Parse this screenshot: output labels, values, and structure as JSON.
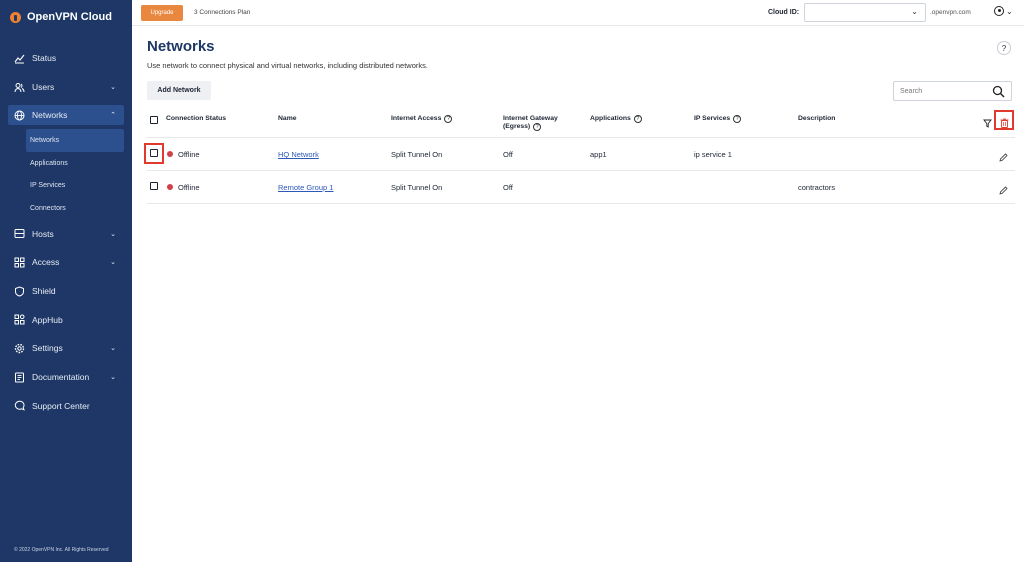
{
  "brand": {
    "name": "OpenVPN Cloud"
  },
  "colors": {
    "sidebar": "#1e3766",
    "accent": "#e9873f",
    "status_offline": "#d2404a",
    "highlight": "#e03a2f",
    "link": "#2c58b8"
  },
  "sidebar": {
    "items": [
      {
        "label": "Status",
        "icon": "chart-line-icon",
        "chevron": false
      },
      {
        "label": "Users",
        "icon": "users-icon",
        "chevron": true
      },
      {
        "label": "Networks",
        "icon": "globe-icon",
        "chevron": true,
        "expanded": true
      },
      {
        "label": "Hosts",
        "icon": "server-icon",
        "chevron": true
      },
      {
        "label": "Access",
        "icon": "grid-icon",
        "chevron": true
      },
      {
        "label": "Shield",
        "icon": "shield-icon",
        "chevron": false
      },
      {
        "label": "AppHub",
        "icon": "apphub-icon",
        "chevron": false
      },
      {
        "label": "Settings",
        "icon": "gear-icon",
        "chevron": true
      },
      {
        "label": "Documentation",
        "icon": "book-icon",
        "chevron": true
      },
      {
        "label": "Support Center",
        "icon": "chat-icon",
        "chevron": false
      }
    ],
    "subitems": [
      {
        "label": "Networks",
        "active": true
      },
      {
        "label": "Applications",
        "active": false
      },
      {
        "label": "IP Services",
        "active": false
      },
      {
        "label": "Connectors",
        "active": false
      }
    ],
    "footer": "© 2022 OpenVPN Inc. All Rights Reserved"
  },
  "topbar": {
    "upgrade_label": "Upgrade",
    "plan": "3 Connections Plan",
    "cloud_id_label": "Cloud ID:",
    "cloud_id_value": "",
    "domain": ".openvpn.com"
  },
  "page": {
    "title": "Networks",
    "subtitle": "Use network to connect physical and virtual networks, including distributed networks.",
    "add_button": "Add Network",
    "search_placeholder": "Search"
  },
  "table": {
    "headers": {
      "status": "Connection Status",
      "name": "Name",
      "internet_access": "Internet Access",
      "gateway_line1": "Internet Gateway",
      "gateway_line2": "(Egress)",
      "applications": "Applications",
      "ip_services": "IP Services",
      "description": "Description"
    },
    "rows": [
      {
        "status": "Offline",
        "name": "HQ Network",
        "internet_access": "Split Tunnel On",
        "gateway": "Off",
        "applications": "app1",
        "ip_services": "ip service 1",
        "description": ""
      },
      {
        "status": "Offline",
        "name": "Remote Group 1",
        "internet_access": "Split Tunnel On",
        "gateway": "Off",
        "applications": "",
        "ip_services": "",
        "description": "contractors"
      }
    ]
  }
}
